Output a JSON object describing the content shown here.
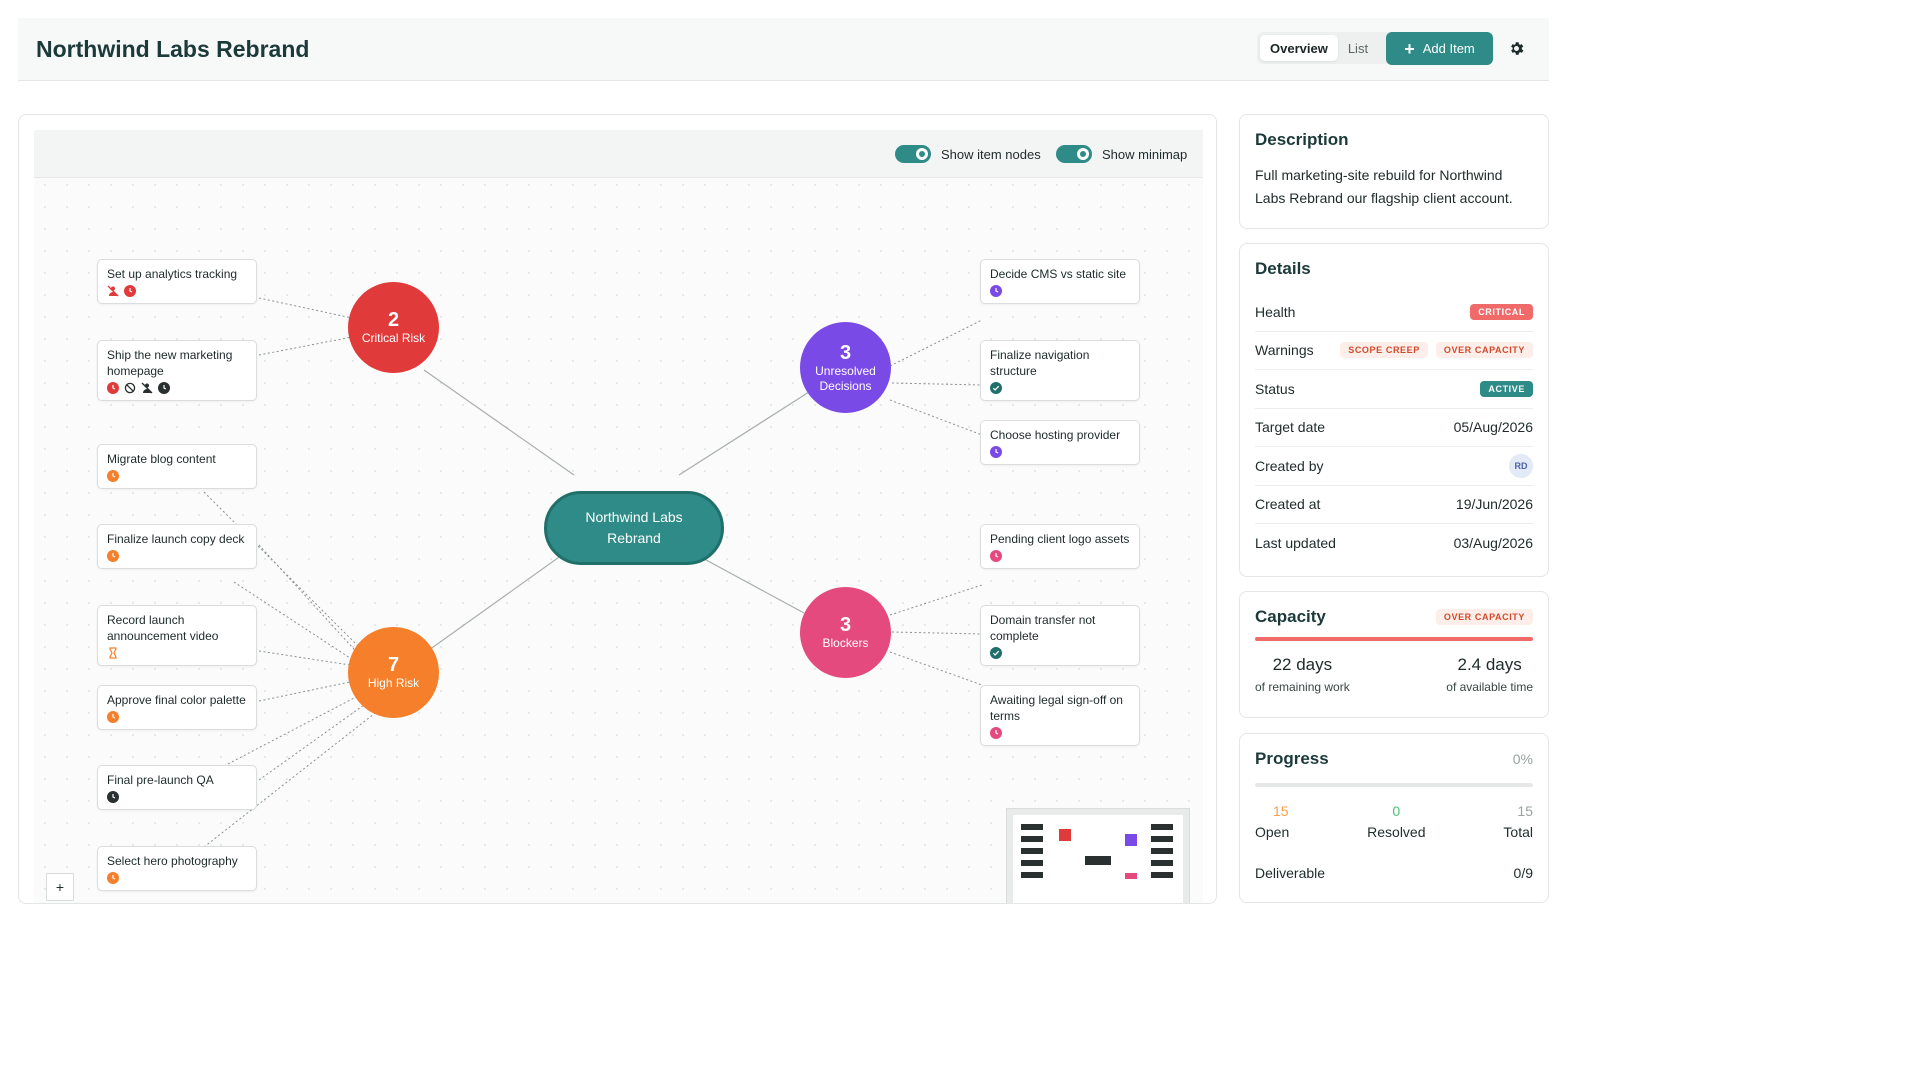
{
  "header": {
    "title": "Northwind Labs Rebrand",
    "view_tabs": [
      "Overview",
      "List"
    ],
    "add_label": "Add Item"
  },
  "toolbar": {
    "show_item_nodes": "Show item nodes",
    "show_minimap": "Show minimap"
  },
  "map": {
    "root": "Northwind Labs Rebrand",
    "hubs": [
      {
        "count": "2",
        "label": "Critical Risk",
        "color": "#e03a3a"
      },
      {
        "count": "3",
        "label": "Unresolved Decisions",
        "color": "#7a4ae6"
      },
      {
        "count": "7",
        "label": "High Risk",
        "color": "#f57f2a"
      },
      {
        "count": "3",
        "label": "Blockers",
        "color": "#e44a7e"
      }
    ],
    "items": [
      "Set up analytics tracking",
      "Ship the new marketing homepage",
      "Migrate blog content",
      "Finalize launch copy deck",
      "Record launch announcement video",
      "Approve final color palette",
      "Final pre-launch QA",
      "Select hero photography",
      "Decide CMS vs static site",
      "Finalize navigation structure",
      "Choose hosting provider",
      "Pending client logo assets",
      "Domain transfer not complete",
      "Awaiting legal sign-off on terms"
    ]
  },
  "sidebar": {
    "description": {
      "title": "Description",
      "text": "Full marketing-site rebuild for Northwind Labs Rebrand our flagship client account."
    },
    "details": {
      "title": "Details",
      "health_label": "Health",
      "health_value": "CRITICAL",
      "warnings_label": "Warnings",
      "warnings": [
        "SCOPE CREEP",
        "OVER CAPACITY"
      ],
      "status_label": "Status",
      "status_value": "ACTIVE",
      "target_label": "Target date",
      "target_value": "05/Aug/2026",
      "created_by_label": "Created by",
      "created_by_value": "RD",
      "created_at_label": "Created at",
      "created_at_value": "19/Jun/2026",
      "updated_label": "Last updated",
      "updated_value": "03/Aug/2026"
    },
    "capacity": {
      "title": "Capacity",
      "badge": "OVER CAPACITY",
      "remaining_value": "22 days",
      "remaining_label": "of remaining work",
      "available_value": "2.4 days",
      "available_label": "of available time"
    },
    "progress": {
      "title": "Progress",
      "percent": "0%",
      "open_count": "15",
      "open_label": "Open",
      "resolved_count": "0",
      "resolved_label": "Resolved",
      "total_count": "15",
      "total_label": "Total",
      "deliverable_label": "Deliverable",
      "deliverable_value": "0/9"
    }
  }
}
